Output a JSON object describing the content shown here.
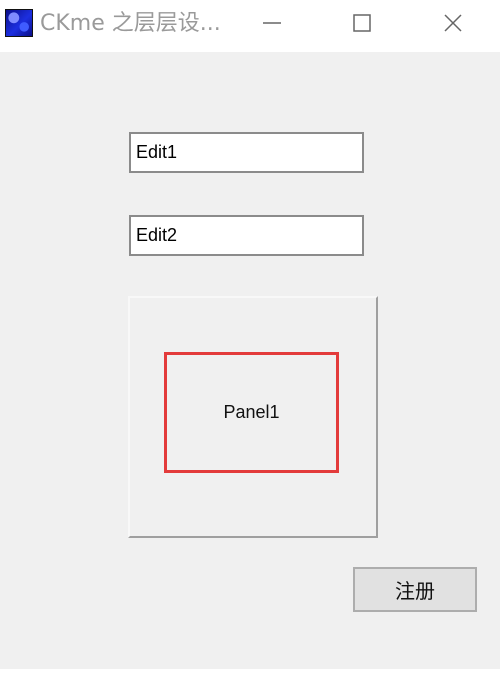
{
  "window": {
    "title": "CKme 之层层设...",
    "icons": {
      "app": "app-icon",
      "minimize": "minimize-icon",
      "maximize": "maximize-icon",
      "close": "close-icon"
    }
  },
  "form": {
    "edit1": "Edit1",
    "edit2": "Edit2",
    "panel1_label": "Panel1",
    "register_label": "注册"
  },
  "colors": {
    "client_background": "#f0f0f0",
    "panel_highlight": "#e33b3b",
    "title_text": "#9a9a9a"
  }
}
